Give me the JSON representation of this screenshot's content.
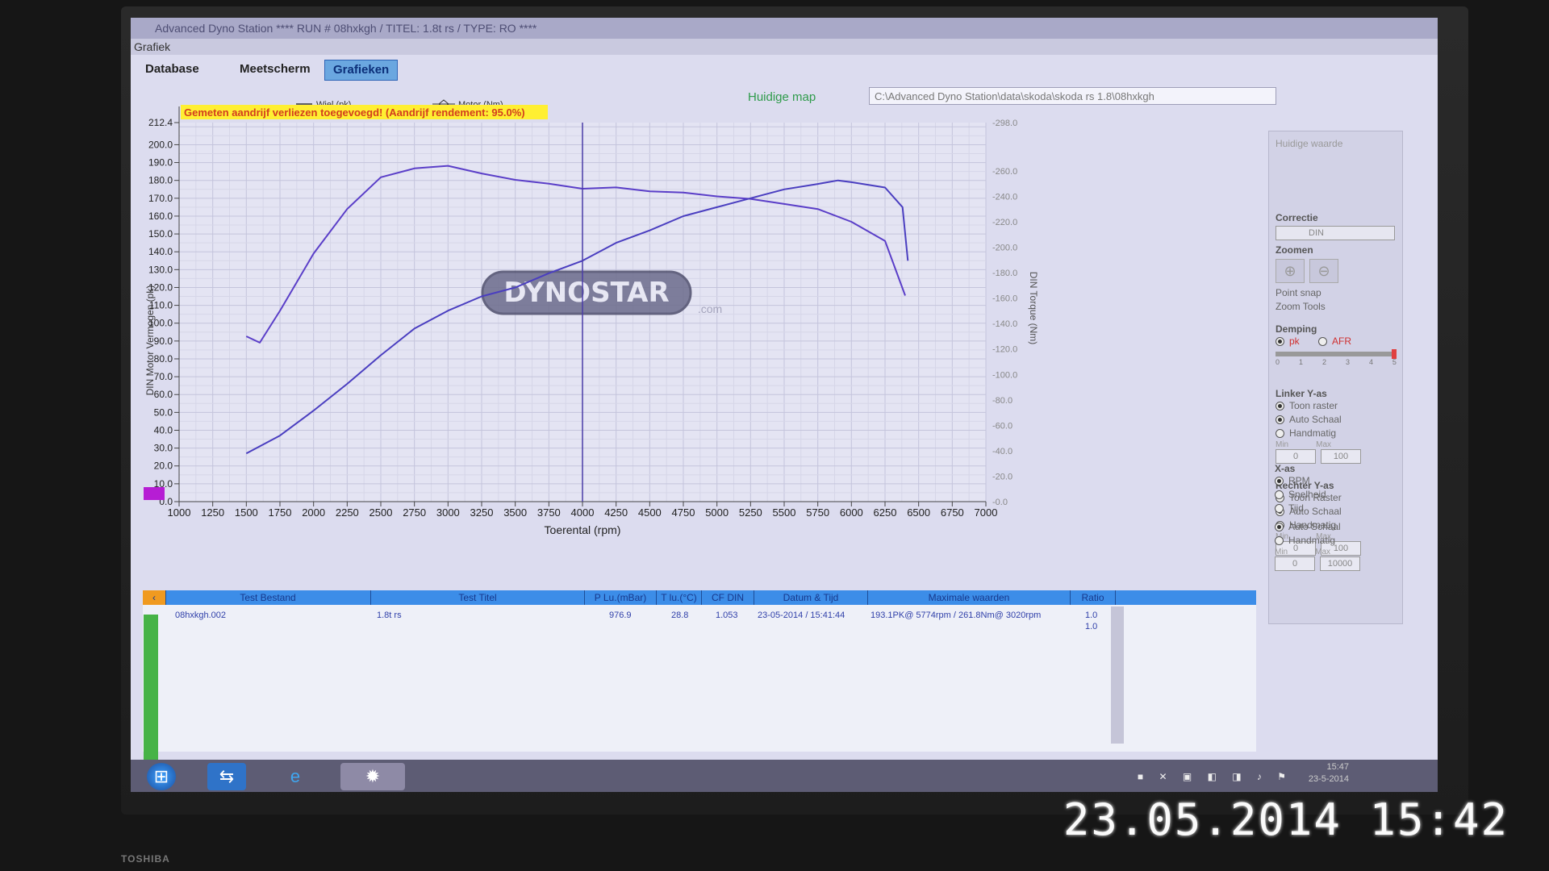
{
  "window": {
    "title": "Advanced Dyno Station   **** RUN # 08hxkgh  /  TITEL: 1.8t rs  /  TYPE: RO ****",
    "menu": "Grafiek"
  },
  "tabs": [
    {
      "label": "Database"
    },
    {
      "label": "Meetscherm"
    },
    {
      "label": "Grafieken"
    }
  ],
  "legend": {
    "wheel": "Wiel (pk)",
    "engine": "Motor (Nm)"
  },
  "map": {
    "label": "Huidige map",
    "path": "C:\\Advanced Dyno Station\\data\\skoda\\skoda rs 1.8\\08hxkgh"
  },
  "warning": "Gemeten aandrijf verliezen toegevoegd! (Aandrijf rendement: 95.0%)",
  "watermark": {
    "logo": "DYNOSTAR",
    "suffix": ".com"
  },
  "chart_data": {
    "type": "line",
    "xlabel": "Toerental (rpm)",
    "ylabel": "DIN Motor Vermogen (pk)",
    "y2label": "DIN Torque (Nm)",
    "xlim": [
      1000,
      7000
    ],
    "ylim": [
      0,
      212.4
    ],
    "y2lim": [
      0,
      298
    ],
    "x_ticks": [
      1000,
      1250,
      1500,
      1750,
      2000,
      2250,
      2500,
      2750,
      3000,
      3250,
      3500,
      3750,
      4000,
      4250,
      4500,
      4750,
      5000,
      5250,
      5500,
      5750,
      6000,
      6250,
      6500,
      6750,
      7000
    ],
    "y_ticks": [
      "212.4",
      "200.0",
      "190.0",
      "180.0",
      "170.0",
      "160.0",
      "150.0",
      "140.0",
      "130.0",
      "120.0",
      "110.0",
      "100.0",
      "90.0",
      "80.0",
      "70.0",
      "60.0",
      "50.0",
      "40.0",
      "30.0",
      "20.0",
      "10.0",
      "0.0"
    ],
    "y2_ticks": [
      "-298.0",
      "-260.0",
      "-240.0",
      "-220.0",
      "-200.0",
      "-180.0",
      "-160.0",
      "-140.0",
      "-120.0",
      "-100.0",
      "-80.0",
      "-60.0",
      "-40.0",
      "-20.0",
      "-0.0"
    ],
    "cursor_rpm": 4000,
    "series": [
      {
        "name": "Motor (Nm)",
        "axis": "right",
        "color": "#5a3ec8",
        "x": [
          1500,
          1600,
          1750,
          2000,
          2250,
          2500,
          2750,
          3000,
          3250,
          3500,
          3750,
          4000,
          4250,
          4500,
          4750,
          5000,
          5250,
          5500,
          5750,
          6000,
          6250,
          6400
        ],
        "values": [
          130,
          125,
          150,
          195,
          230,
          255,
          262,
          264,
          258,
          253,
          250,
          246,
          247,
          244,
          243,
          240,
          238,
          234,
          230,
          220,
          205,
          162
        ]
      },
      {
        "name": "Wiel (pk)",
        "axis": "left",
        "color": "#4a3ec0",
        "x": [
          1500,
          1750,
          2000,
          2250,
          2500,
          2750,
          3000,
          3250,
          3500,
          3750,
          4000,
          4250,
          4500,
          4750,
          5000,
          5250,
          5500,
          5750,
          5900,
          6000,
          6250,
          6380,
          6420
        ],
        "values": [
          27,
          37,
          51,
          66,
          82,
          97,
          107,
          115,
          120,
          128,
          135,
          145,
          152,
          160,
          165,
          170,
          175,
          178,
          180,
          179,
          176,
          165,
          135
        ]
      }
    ]
  },
  "table": {
    "headers": [
      "Test Bestand",
      "Test Titel",
      "P Lu.(mBar)",
      "T lu.(°C)",
      "CF DIN",
      "Datum & Tijd",
      "Maximale waarden",
      "Ratio"
    ],
    "rows": [
      [
        "08hxkgh.002",
        "1.8t rs",
        "976.9",
        "28.8",
        "1.053",
        "23-05-2014 / 15:41:44",
        "193.1PK@ 5774rpm / 261.8Nm@ 3020rpm",
        "1.0"
      ]
    ],
    "ratio_second": "1.0"
  },
  "side_panel": {
    "header": "Huidige waarde",
    "correctie": {
      "title": "Correctie",
      "value": "DIN"
    },
    "zoomen": {
      "title": "Zoomen",
      "point_snap": "Point snap",
      "zoom_tools": "Zoom Tools"
    },
    "demping": {
      "title": "Demping",
      "options": [
        "pk",
        "AFR"
      ],
      "scale": [
        "0",
        "1",
        "2",
        "3",
        "4",
        "5"
      ]
    },
    "linker": {
      "title": "Linker Y-as",
      "options": [
        "Toon raster",
        "Auto Schaal",
        "Handmatig"
      ],
      "min_label": "Min",
      "max_label": "Max",
      "min": "0",
      "max": "100"
    },
    "rechter": {
      "title": "Rechter Y-as",
      "options": [
        "Toon Raster",
        "Auto Schaal",
        "Handmatig"
      ],
      "min_label": "Min",
      "max_label": "Max",
      "min": "0",
      "max": "100"
    },
    "xas": {
      "title": "X-as",
      "options": [
        "RPM",
        "Snelheid",
        "Tijd"
      ],
      "scale_options": [
        "Auto Schaal",
        "Handmatig"
      ],
      "min_label": "Min",
      "max_label": "Max",
      "min": "0",
      "max": "10000"
    }
  },
  "taskbar": {
    "time": "15:47",
    "date": "23-5-2014"
  },
  "camera_stamp": "23.05.2014  15:42",
  "monitor_brand": "TOSHIBA"
}
